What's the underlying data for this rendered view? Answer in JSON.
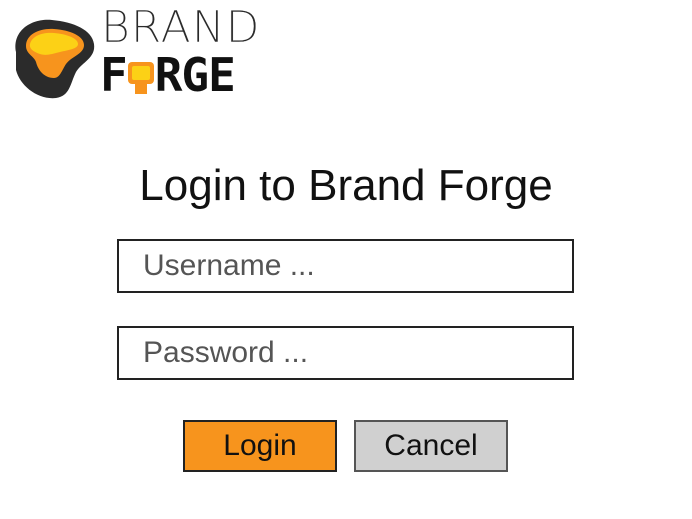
{
  "brand": {
    "word_top": "BRAND",
    "word_bottom_f": "F",
    "word_bottom_rest": "RGE",
    "logo_name": "brand-forge-logo"
  },
  "login": {
    "title": "Login to Brand Forge",
    "username_placeholder": "Username ...",
    "password_placeholder": "Password ...",
    "login_label": "Login",
    "cancel_label": "Cancel"
  },
  "colors": {
    "accent_orange": "#f7941d",
    "cancel_gray": "#d0d0d0",
    "logo_dark": "#2b2b2b",
    "logo_yellow": "#fcd116",
    "logo_orange": "#f7941d"
  }
}
